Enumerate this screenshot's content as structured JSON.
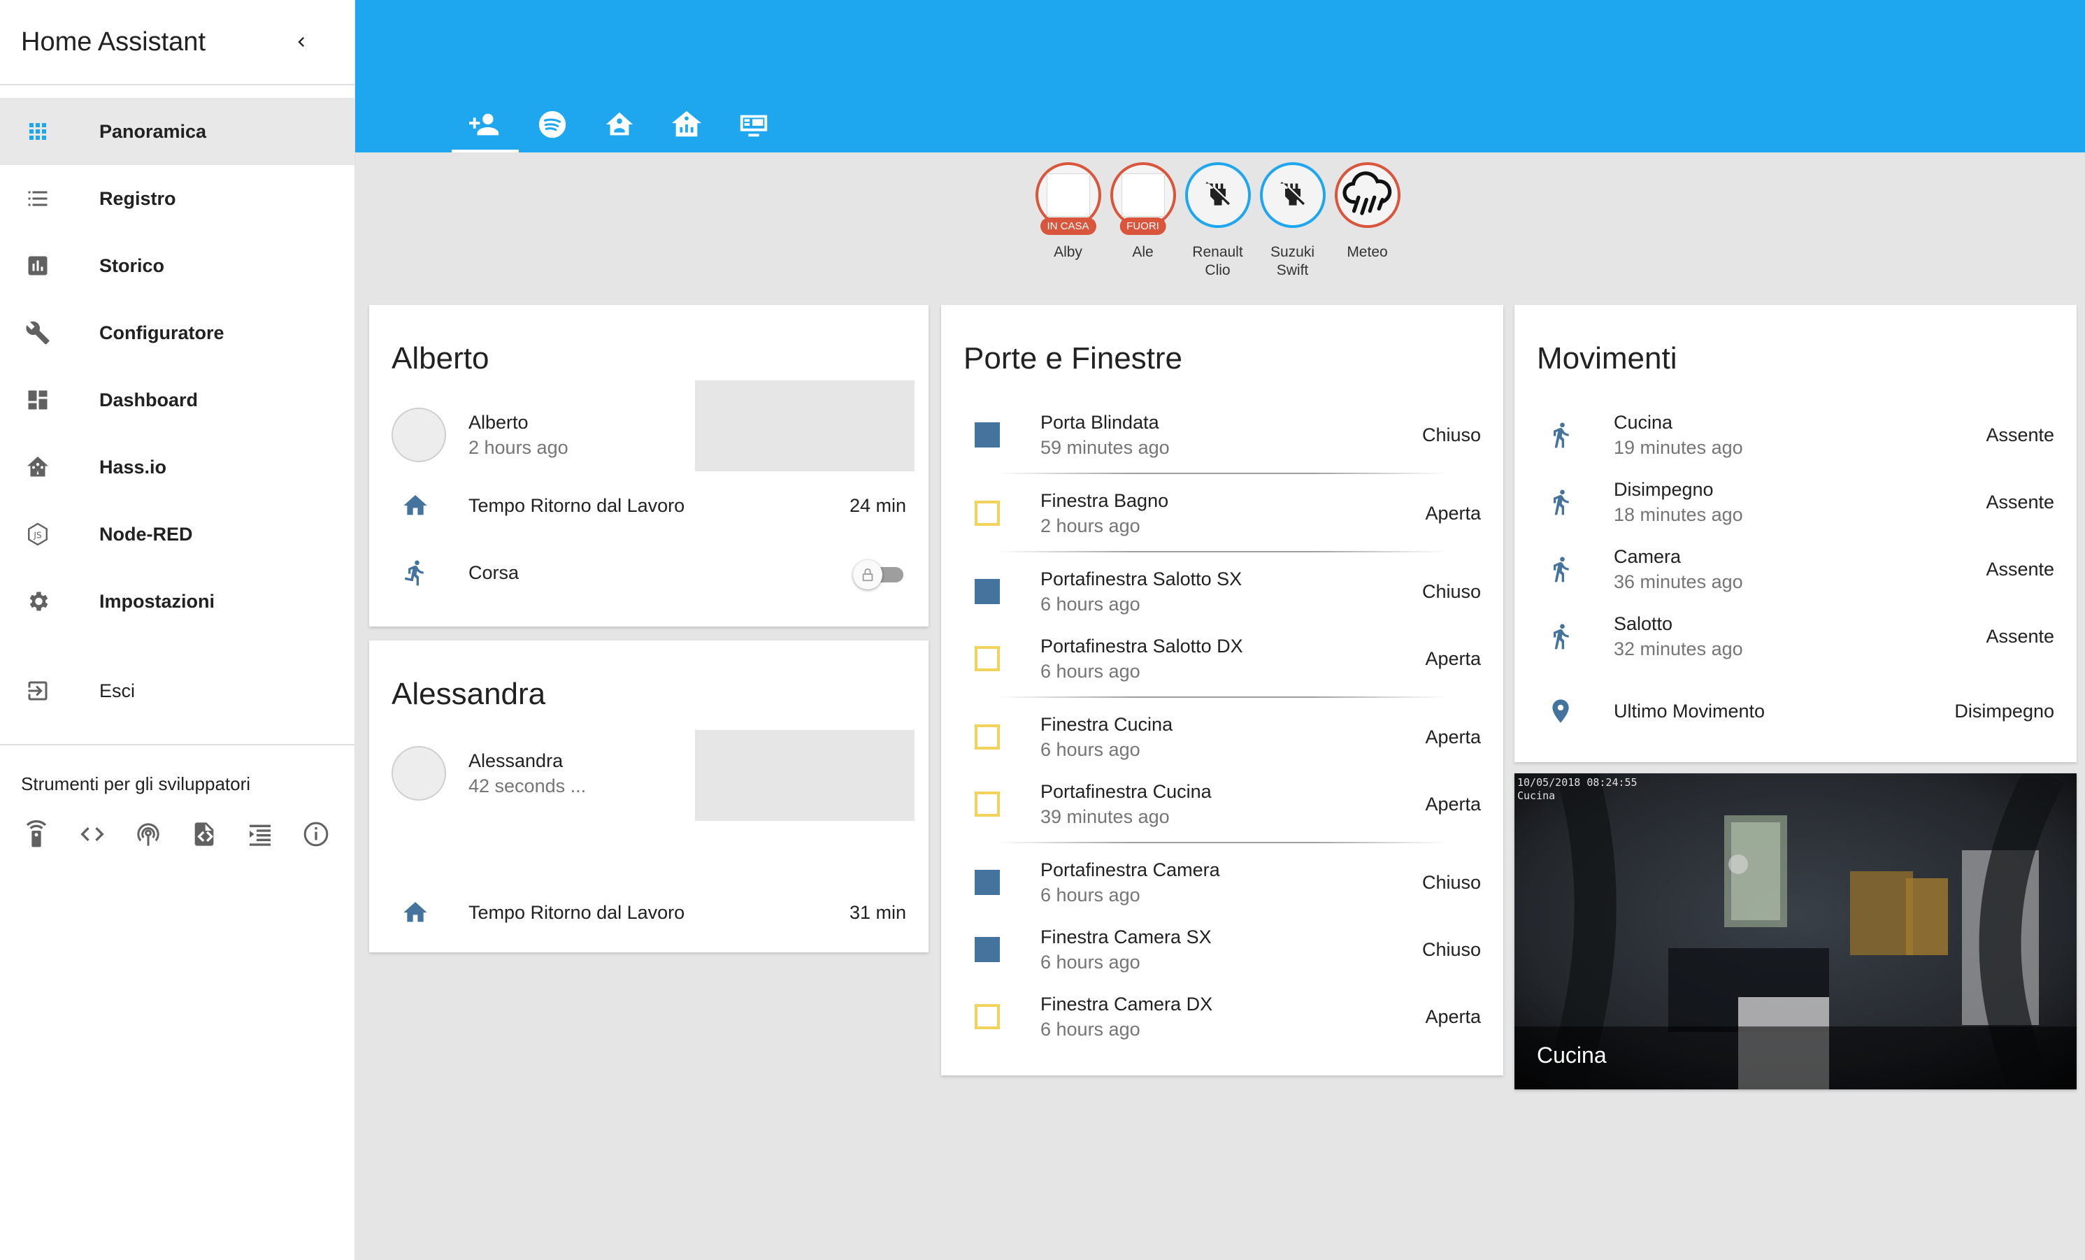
{
  "sidebar": {
    "title": "Home Assistant",
    "items": [
      {
        "label": "Panoramica",
        "icon": "grid-icon"
      },
      {
        "label": "Registro",
        "icon": "list-icon"
      },
      {
        "label": "Storico",
        "icon": "chart-icon"
      },
      {
        "label": "Configuratore",
        "icon": "wrench-icon"
      },
      {
        "label": "Dashboard",
        "icon": "dashboard-icon"
      },
      {
        "label": "Hass.io",
        "icon": "hassio-icon"
      },
      {
        "label": "Node-RED",
        "icon": "nodejs-icon"
      },
      {
        "label": "Impostazioni",
        "icon": "gear-icon"
      },
      {
        "label": "Esci",
        "icon": "logout-icon"
      }
    ],
    "dev_title": "Strumenti per gli sviluppatori",
    "dev_tools": [
      "remote-icon",
      "code-icon",
      "broadcast-icon",
      "file-code-icon",
      "template-icon",
      "info-icon"
    ]
  },
  "header": {
    "accent": "#1ea7ef",
    "tabs": [
      "people-icon",
      "spotify-icon",
      "home-account-icon",
      "home-group-icon",
      "display-icon"
    ]
  },
  "badges": [
    {
      "label": "Alby",
      "tag": "IN CASA",
      "kind": "photo"
    },
    {
      "label": "Ale",
      "tag": "FUORI",
      "kind": "photo"
    },
    {
      "label": "Renault\nClio",
      "kind": "power-plug-off-icon"
    },
    {
      "label": "Suzuki\nSwift",
      "kind": "power-plug-off-icon"
    },
    {
      "label": "Meteo",
      "kind": "weather-pouring-icon"
    }
  ],
  "cards": {
    "alberto": {
      "title": "Alberto",
      "person": {
        "name": "Alberto",
        "sub": "2 hours ago"
      },
      "commute": {
        "name": "Tempo Ritorno dal Lavoro",
        "value": "24 min"
      },
      "run": {
        "name": "Corsa"
      }
    },
    "alessandra": {
      "title": "Alessandra",
      "person": {
        "name": "Alessandra",
        "sub": "42 seconds ..."
      },
      "commute": {
        "name": "Tempo Ritorno dal Lavoro",
        "value": "31 min"
      }
    },
    "porte": {
      "title": "Porte e Finestre",
      "rows": [
        {
          "name": "Porta Blindata",
          "sub": "59 minutes ago",
          "state": "Chiuso",
          "closed": true
        },
        {
          "name": "Finestra Bagno",
          "sub": "2 hours ago",
          "state": "Aperta",
          "closed": false
        },
        {
          "name": "Portafinestra Salotto SX",
          "sub": "6 hours ago",
          "state": "Chiuso",
          "closed": true
        },
        {
          "name": "Portafinestra Salotto DX",
          "sub": "6 hours ago",
          "state": "Aperta",
          "closed": false
        },
        {
          "name": "Finestra Cucina",
          "sub": "6 hours ago",
          "state": "Aperta",
          "closed": false
        },
        {
          "name": "Portafinestra Cucina",
          "sub": "39 minutes ago",
          "state": "Aperta",
          "closed": false
        },
        {
          "name": "Portafinestra Camera",
          "sub": "6 hours ago",
          "state": "Chiuso",
          "closed": true
        },
        {
          "name": "Finestra Camera SX",
          "sub": "6 hours ago",
          "state": "Chiuso",
          "closed": true
        },
        {
          "name": "Finestra Camera DX",
          "sub": "6 hours ago",
          "state": "Aperta",
          "closed": false
        }
      ]
    },
    "movimenti": {
      "title": "Movimenti",
      "rows": [
        {
          "name": "Cucina",
          "sub": "19 minutes ago",
          "state": "Assente"
        },
        {
          "name": "Disimpegno",
          "sub": "18 minutes ago",
          "state": "Assente"
        },
        {
          "name": "Camera",
          "sub": "36 minutes ago",
          "state": "Assente"
        },
        {
          "name": "Salotto",
          "sub": "32 minutes ago",
          "state": "Assente"
        }
      ],
      "last": {
        "name": "Ultimo Movimento",
        "state": "Disimpegno"
      }
    }
  },
  "camera": {
    "stamp_line1": "10/05/2018 08:24:55",
    "stamp_line2": "Cucina",
    "title": "Cucina"
  },
  "colors": {
    "icon": "#44739e",
    "badge_red": "#d9553c",
    "open_yellow": "#f1d25a"
  }
}
